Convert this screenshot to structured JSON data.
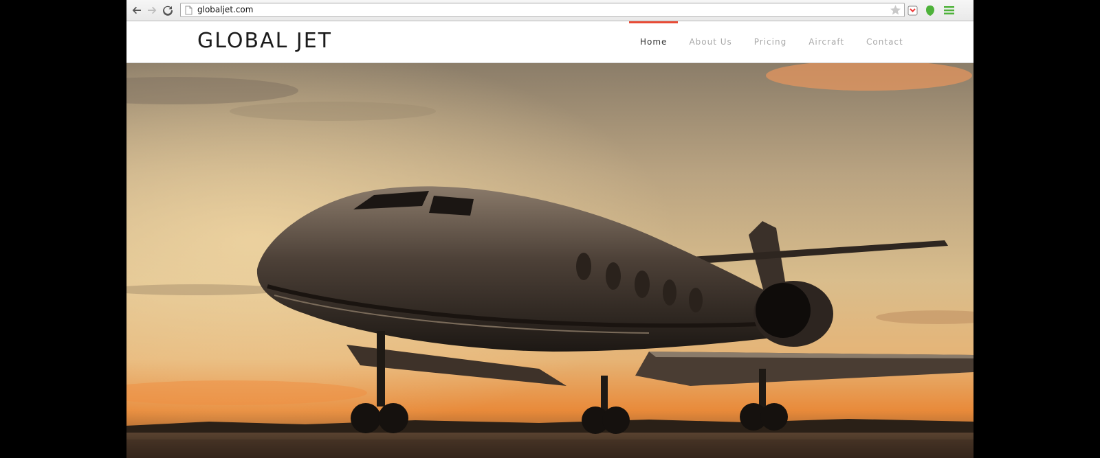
{
  "browser": {
    "url": "globaljet.com",
    "icons": {
      "back": "back-arrow-icon",
      "forward": "forward-arrow-icon",
      "reload": "reload-icon",
      "page": "page-icon",
      "bookmark": "star-icon",
      "ext1": "pocket-extension-icon",
      "ext2": "evernote-extension-icon",
      "menu": "hamburger-menu-icon"
    }
  },
  "site": {
    "logo": "GLOBAL JET",
    "accent_color": "#e94b35",
    "nav": [
      {
        "label": "Home",
        "active": true
      },
      {
        "label": "About Us",
        "active": false
      },
      {
        "label": "Pricing",
        "active": false
      },
      {
        "label": "Aircraft",
        "active": false
      },
      {
        "label": "Contact",
        "active": false
      }
    ]
  },
  "hero": {
    "image": "private-jet-at-sunset"
  }
}
